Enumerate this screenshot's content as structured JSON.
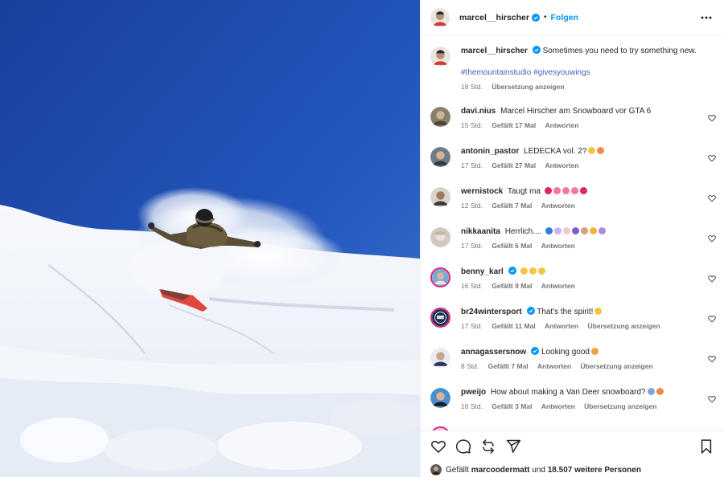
{
  "post": {
    "author": "marcel__hirscher",
    "dot": "•",
    "follow_label": "Folgen",
    "more_icon": "more-horizontal-icon",
    "caption": "Sometimes you need to try something new.",
    "hashtags": [
      "#themountainstudio",
      "#givesyouwings"
    ],
    "caption_time": "18 Std.",
    "translate_label": "Übersetzung anzeigen",
    "verified_color": "#0095f6"
  },
  "comments": [
    {
      "user": "davi.nius",
      "verified": false,
      "text": "Marcel Hirscher am Snowboard vor GTA 6",
      "time": "15 Std.",
      "likes": "Gefällt 17 Mal",
      "reply": "Antworten",
      "translate": ""
    },
    {
      "user": "antonin_pastor",
      "verified": false,
      "text": "LEDECKA vol. 2?",
      "time": "17 Std.",
      "likes": "Gefällt 27 Mal",
      "reply": "Antworten",
      "translate": ""
    },
    {
      "user": "wernistock",
      "verified": false,
      "text": "Taugt ma",
      "time": "12 Std.",
      "likes": "Gefällt 7 Mal",
      "reply": "Antworten",
      "translate": ""
    },
    {
      "user": "nikkaanita",
      "verified": false,
      "text": "Herrlich....",
      "time": "17 Std.",
      "likes": "Gefällt 6 Mal",
      "reply": "Antworten",
      "translate": ""
    },
    {
      "user": "benny_karl",
      "verified": true,
      "text": "",
      "time": "16 Std.",
      "likes": "Gefällt 9 Mal",
      "reply": "Antworten",
      "translate": ""
    },
    {
      "user": "br24wintersport",
      "verified": true,
      "text": "That's the spirit!",
      "time": "17 Std.",
      "likes": "Gefällt 11 Mal",
      "reply": "Antworten",
      "translate": "Übersetzung anzeigen"
    },
    {
      "user": "annagassersnow",
      "verified": true,
      "text": "Looking good",
      "time": "8 Std.",
      "likes": "Gefällt 7 Mal",
      "reply": "Antworten",
      "translate": "Übersetzung anzeigen"
    },
    {
      "user": "pweijo",
      "verified": false,
      "text": "How about making a Van Deer snowboard?",
      "time": "16 Std.",
      "likes": "Gefällt 3 Mal",
      "reply": "Antworten",
      "translate": "Übersetzung anzeigen"
    }
  ],
  "footer": {
    "likes_prefix": "Gefällt",
    "likes_user": "marcoodermatt",
    "likes_and": "und",
    "likes_others": "18.507 weitere Personen",
    "icons": [
      "heart-icon",
      "comment-icon",
      "share-icon",
      "send-icon",
      "bookmark-icon"
    ]
  }
}
